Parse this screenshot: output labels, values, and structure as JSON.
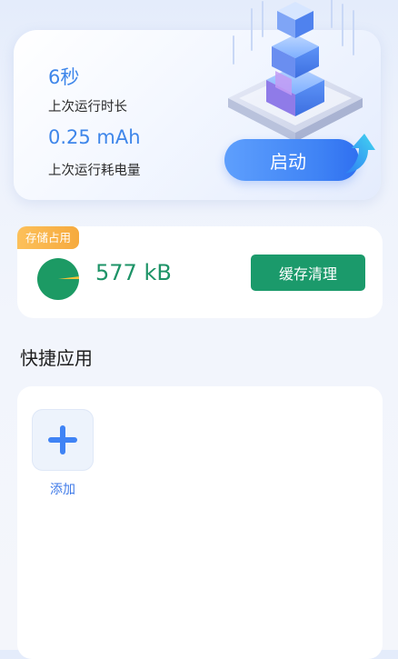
{
  "stats": {
    "duration_value": "6秒",
    "duration_label": "上次运行时长",
    "power_value": "0.25 mAh",
    "power_label": "上次运行耗电量",
    "start_label": "启动"
  },
  "storage": {
    "tag": "存储占用",
    "size": "577 kB",
    "clean_label": "缓存清理",
    "used_fraction": 0.02
  },
  "quick_apps": {
    "title": "快捷应用",
    "add_label": "添加"
  },
  "colors": {
    "accent_blue": "#3f83f5",
    "storage_green": "#1b9a6b",
    "tag_orange": "#f6aa3e"
  },
  "icons": {
    "start_arrow": "up-right-arrow-icon",
    "hero": "stacked-cubes-illustration",
    "add": "plus-icon"
  }
}
